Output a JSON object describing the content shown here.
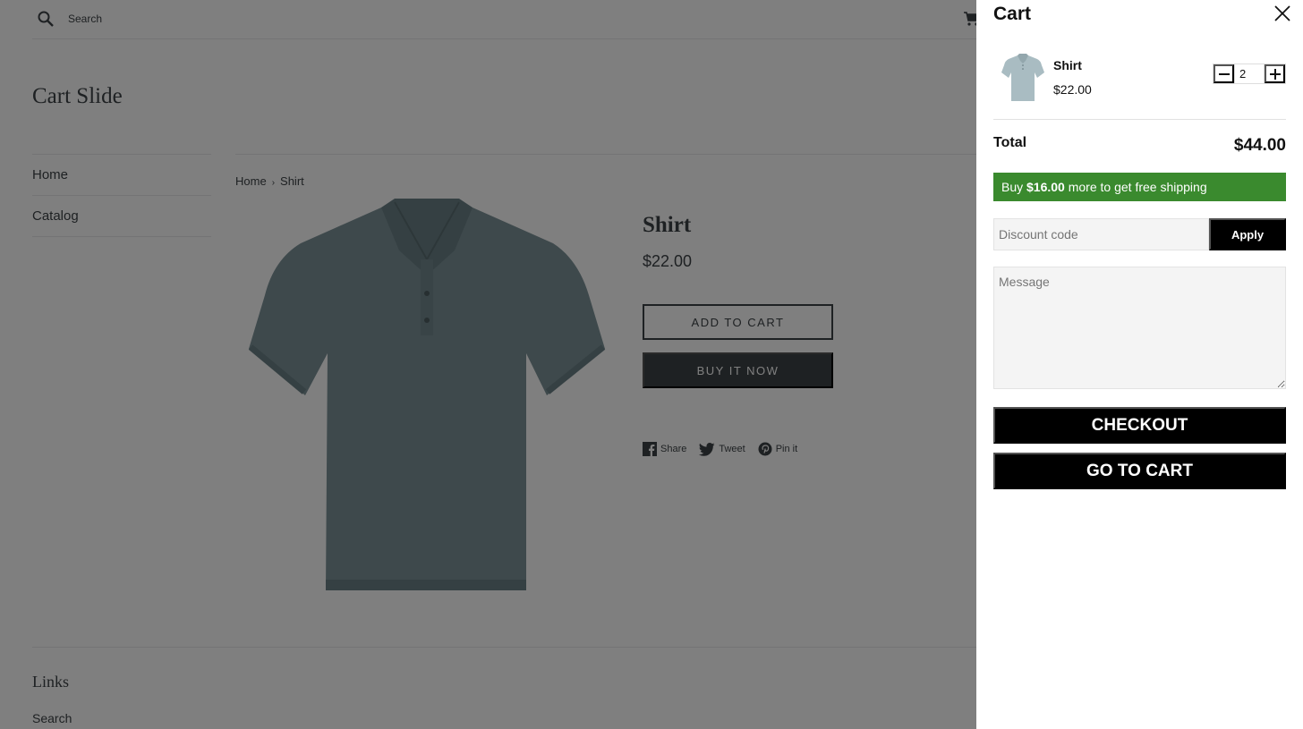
{
  "store": {
    "search_label": "Search",
    "logo": "Cart Slide",
    "nav": [
      {
        "label": "Home"
      },
      {
        "label": "Catalog"
      }
    ],
    "breadcrumb": {
      "home": "Home",
      "separator": "›",
      "current": "Shirt"
    },
    "product": {
      "title": "Shirt",
      "price": "$22.00",
      "add_to_cart": "ADD TO CART",
      "buy_it_now": "BUY IT NOW",
      "image_icon": "polo-shirt-image"
    },
    "share": {
      "facebook": "Share",
      "twitter": "Tweet",
      "pinterest": "Pin it"
    },
    "footer": {
      "title": "Links",
      "link": "Search"
    },
    "overlay_color": "rgba(0,0,0,0.5)"
  },
  "cart": {
    "title": "Cart",
    "items": [
      {
        "name": "Shirt",
        "price": "$22.00",
        "quantity": "2"
      }
    ],
    "total_label": "Total",
    "total_value": "$44.00",
    "shipping": {
      "prefix": "Buy",
      "amount": "$16.00",
      "suffix": "more to get free shipping",
      "color": "#3a8a2e"
    },
    "discount_placeholder": "Discount code",
    "apply_label": "Apply",
    "message_placeholder": "Message",
    "checkout_label": "CHECKOUT",
    "go_to_cart_label": "GO TO CART"
  }
}
